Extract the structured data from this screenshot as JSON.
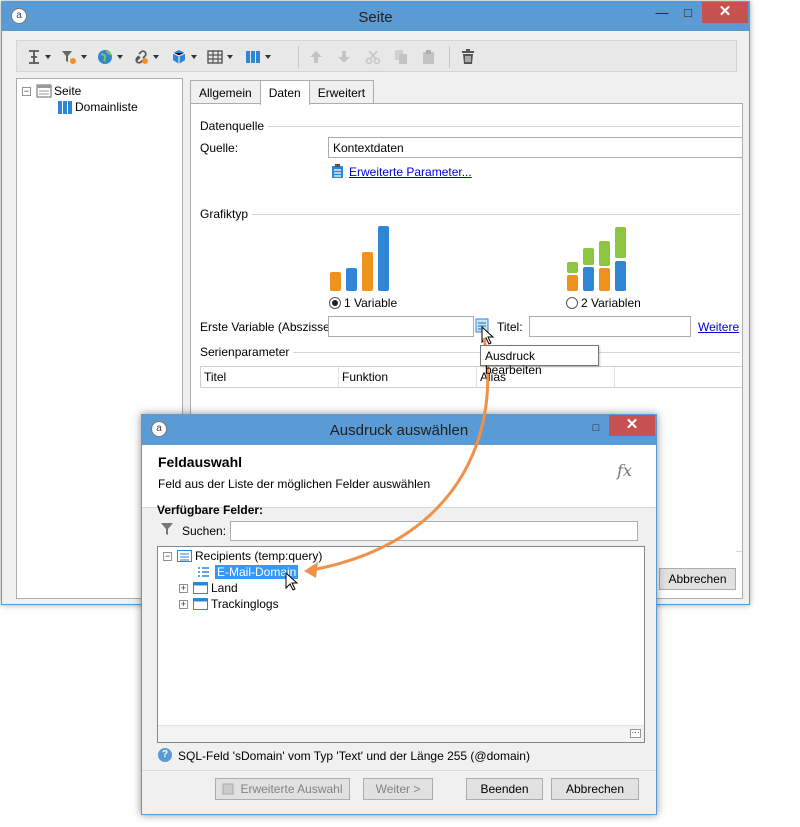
{
  "main_window": {
    "title": "Seite",
    "tree": {
      "root": "Seite",
      "child": "Domainliste"
    },
    "tabs": [
      "Allgemein",
      "Daten",
      "Erweitert"
    ],
    "active_tab": "Daten",
    "data_source": {
      "group_label": "Datenquelle",
      "source_label": "Quelle:",
      "source_value": "Kontextdaten",
      "advanced_params_link": "Erweiterte Parameter..."
    },
    "chart_type": {
      "group_label": "Grafiktyp",
      "option1": "1 Variable",
      "option2": "2 Variablen",
      "selected": "1 Variable"
    },
    "first_variable_label": "Erste Variable (Abszisse):",
    "first_variable_value": "",
    "title_label": "Titel:",
    "title_value": "",
    "more_link": "Weitere",
    "series_group_label": "Serienparameter",
    "series_columns": [
      "Titel",
      "Funktion",
      "Alias"
    ],
    "tooltip": "Ausdruck bearbeiten",
    "cancel_button": "Abbrechen"
  },
  "dialog": {
    "title": "Ausdruck auswählen",
    "heading": "Feldauswahl",
    "subheading": "Feld aus der Liste der möglichen Felder auswählen",
    "fx_symbol": "fx",
    "available_fields_label": "Verfügbare Felder:",
    "search_label": "Suchen:",
    "search_value": "",
    "tree": {
      "root": "Recipients (temp:query)",
      "items": [
        "E-Mail-Domain",
        "Land",
        "Trackinglogs"
      ],
      "selected": "E-Mail-Domain"
    },
    "status_text": "SQL-Feld 'sDomain' vom Typ 'Text' und der Länge 255 (@domain)",
    "buttons": {
      "advanced_selection": "Erweiterte Auswahl",
      "next": "Weiter >",
      "finish": "Beenden",
      "cancel": "Abbrechen"
    }
  },
  "colors": {
    "titlebar": "#5b9bd5",
    "close_button": "#c75050",
    "arrow": "#f0914a",
    "bar_orange": "#f0921e",
    "bar_blue": "#2e86d4",
    "bar_green": "#8cc540",
    "selection": "#3399ff"
  }
}
